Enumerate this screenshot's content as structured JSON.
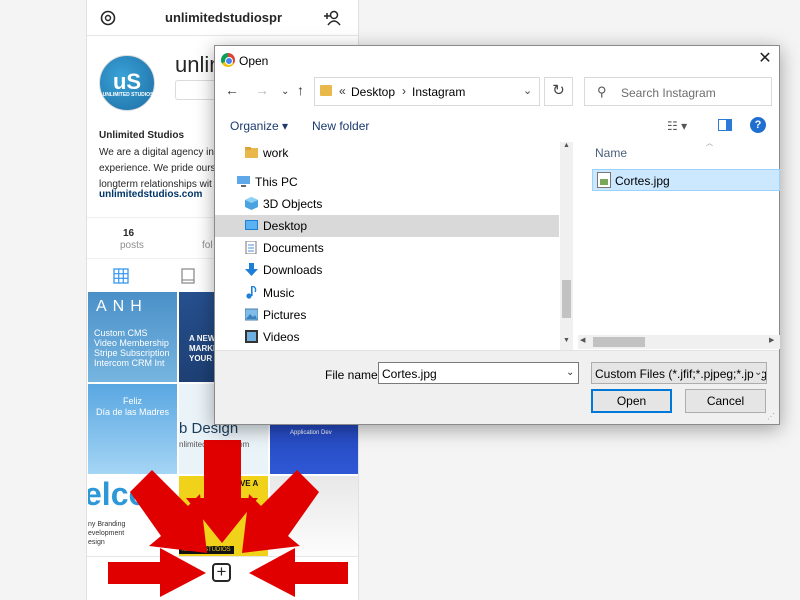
{
  "instagram": {
    "username": "unlimitedstudiospr",
    "name_big": "unlim",
    "avatar_text": "uS",
    "avatar_subtext": "UNLIMITED STUDIOS",
    "full_name": "Unlimited Studios",
    "bio_lines": [
      "We are a digital agency in",
      "experience. We pride ours",
      "longterm relationships wit"
    ],
    "link": "unlimitedstudios.com",
    "posts_count": "16",
    "posts_label": "posts",
    "followers_label_partial": "fol",
    "tiles": {
      "t1_big": "ANH",
      "t1_lines": [
        "Custom CMS",
        "Video Membership",
        "Stripe Subscription",
        "Intercom CRM Int"
      ],
      "t2_lines": [
        "A NEW",
        "MARKET",
        "YOUR"
      ],
      "t4_lines": [
        "Feliz",
        "Día de las Madres"
      ],
      "t5_big": "b Design",
      "t5_small": "nlimitedstudios.com",
      "t6_text": "Application Dev",
      "t7_big": "elco",
      "t7_lines": [
        "ny Branding",
        "evelopment",
        "esign"
      ],
      "t8_text": "HAVE A NO",
      "t8_strip": "IMITED STUDIOS"
    }
  },
  "dialog": {
    "title": "Open",
    "address": {
      "sep": "«",
      "parts": [
        "Desktop",
        "Instagram"
      ]
    },
    "search_placeholder": "Search Instagram",
    "toolbar": {
      "organize": "Organize ▾",
      "new_folder": "New folder"
    },
    "nav_items": [
      {
        "label": "work",
        "icon": "folder-icon"
      },
      {
        "label": "This PC",
        "icon": "computer-icon"
      },
      {
        "label": "3D Objects",
        "icon": "cube-icon"
      },
      {
        "label": "Desktop",
        "icon": "desktop-icon"
      },
      {
        "label": "Documents",
        "icon": "documents-icon"
      },
      {
        "label": "Downloads",
        "icon": "download-icon"
      },
      {
        "label": "Music",
        "icon": "music-icon"
      },
      {
        "label": "Pictures",
        "icon": "pictures-icon"
      },
      {
        "label": "Videos",
        "icon": "videos-icon"
      }
    ],
    "column_name": "Name",
    "file": "Cortes.jpg",
    "file_name_label": "File name:",
    "file_name_value": "Cortes.jpg",
    "file_type": "Custom Files (*.jfif;*.pjpeg;*.jpeg",
    "open_label": "Open",
    "cancel_label": "Cancel"
  },
  "colors": {
    "accent": "#0078d7",
    "arrow": "#e10000",
    "selection": "#cce8ff"
  }
}
